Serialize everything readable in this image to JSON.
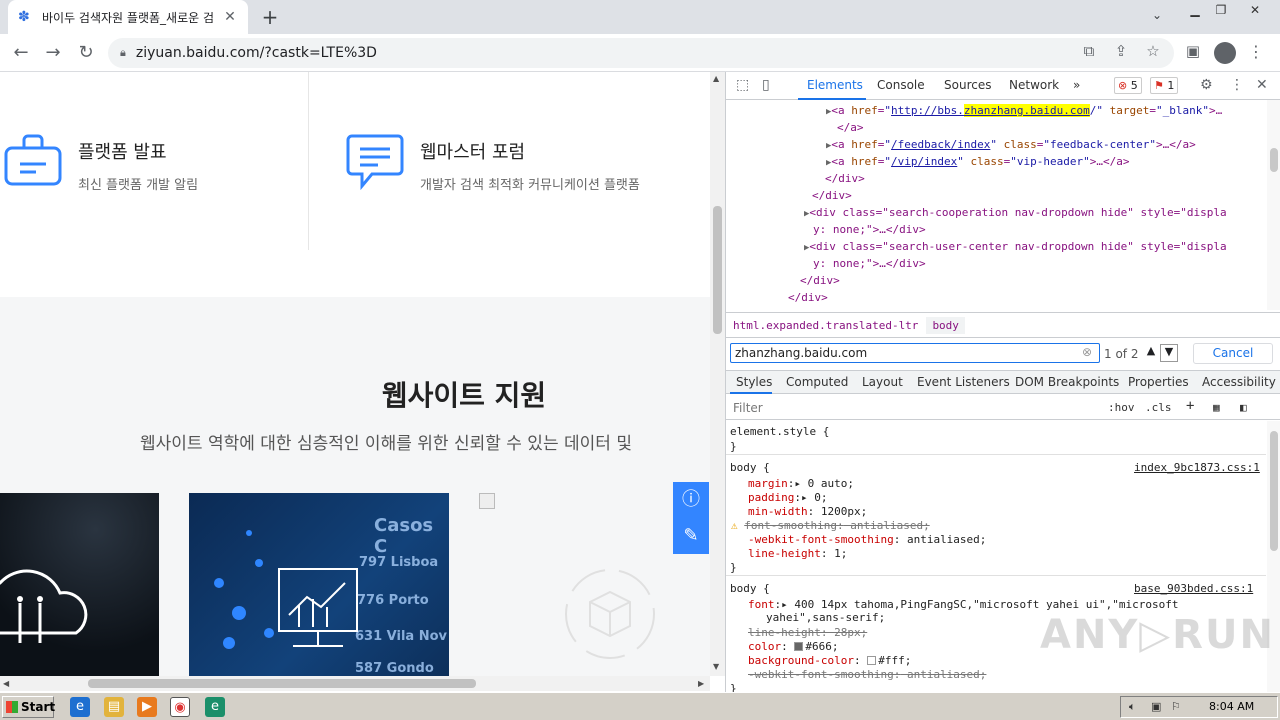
{
  "browser": {
    "tab_title": "바이두 검색자원 플랫폼_새로운 검",
    "tab_close": "✕",
    "new_tab": "+",
    "url": "ziyuan.baidu.com/?castk=LTE%3D"
  },
  "page": {
    "card1": {
      "title": "플랫폼 발표",
      "subtitle": "최신 플랫폼 개발 알림"
    },
    "card2": {
      "title": "웹마스터 포럼",
      "subtitle": "개발자 검색 최적화 커뮤니케이션 플랫폼"
    },
    "section_title": "웹사이트 지원",
    "section_subtitle": "웹사이트 역학에 대한 심층적인 이해를 위한 신뢰할 수 있는 데이터 및",
    "image_numbers": [
      "797 Lisboa",
      "776 Porto",
      "631 Vila Nov",
      "587 Gondo",
      "Casos C"
    ]
  },
  "devtools": {
    "tabs": [
      "Elements",
      "Console",
      "Sources",
      "Network",
      "»"
    ],
    "error_count": "5",
    "issue_count": "1",
    "elements_lines": [
      {
        "pre": "<a href=\"",
        "link": "http://bbs.",
        "hl": "zhanzhang.baidu.com",
        "post": "/\" target=\"_blank\">…"
      },
      {
        "text": "</a>"
      },
      {
        "pre": "<a href=\"",
        "link": "/feedback/index",
        "post": "\" class=\"feedback-center\">…</a>"
      },
      {
        "pre": "<a href=\"",
        "link": "/vip/index",
        "post": "\" class=\"vip-header\">…</a>"
      },
      {
        "text": "</div>"
      },
      {
        "text": "</div>"
      },
      {
        "text": "<div class=\"search-cooperation nav-dropdown hide\" style=\"displa"
      },
      {
        "text": "y: none;\">…</div>"
      },
      {
        "text": "<div class=\"search-user-center nav-dropdown hide\" style=\"displa"
      },
      {
        "text": "y: none;\">…</div>"
      },
      {
        "text": "</div>"
      },
      {
        "text": "</div>"
      }
    ],
    "breadcrumb": [
      "html.expanded.translated-ltr",
      "body"
    ],
    "find": {
      "query": "zhanzhang.baidu.com",
      "count": "1 of 2",
      "cancel": "Cancel"
    },
    "subtabs": [
      "Styles",
      "Computed",
      "Layout",
      "Event Listeners",
      "DOM Breakpoints",
      "Properties",
      "Accessibility"
    ],
    "filter_placeholder": "Filter",
    "filter_hov": ":hov",
    "filter_cls": ".cls",
    "styles": {
      "element_style": "element.style {",
      "close": "}",
      "rule1_selector": "body {",
      "rule1_source": "index_9bc1873.css:1",
      "rule1_props": [
        {
          "p": "margin",
          "v": "▸ 0 auto;"
        },
        {
          "p": "padding",
          "v": "▸ 0;"
        },
        {
          "p": "min-width",
          "v": " 1200px;"
        },
        {
          "p": "font-smoothing",
          "v": " antialiased;",
          "struck": true,
          "warn": true
        },
        {
          "p": "-webkit-font-smoothing",
          "v": " antialiased;"
        },
        {
          "p": "line-height",
          "v": " 1;"
        }
      ],
      "rule2_selector": "body {",
      "rule2_source": "base_903bded.css:1",
      "rule2_font": "▸ 400 14px tahoma,PingFangSC,\"microsoft yahei ui\",\"microsoft",
      "rule2_font_cont": "yahei\",sans-serif;",
      "rule2_lineheight": " 28px;",
      "rule2_color": "#666;",
      "rule2_bg": "#fff;",
      "rule2_smoothing": " antialiased;"
    },
    "colors": {
      "color_666": "#666666",
      "color_fff": "#ffffff"
    }
  },
  "watermark": "ANY▷RUN",
  "taskbar": {
    "start": "Start",
    "time": "8:04 AM"
  }
}
